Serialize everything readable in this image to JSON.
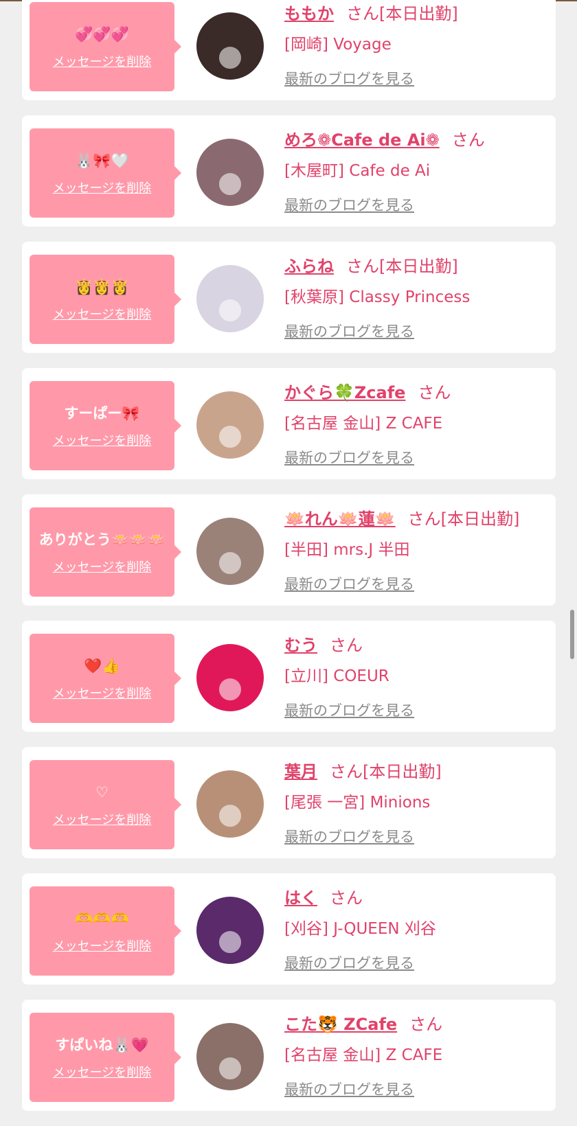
{
  "common": {
    "delete_label": "メッセージを削除",
    "blog_label": "最新のブログを見る",
    "honorific": "さん"
  },
  "colors": {
    "page_bg": "#efefef",
    "card_bg": "#ffffff",
    "bubble_bg": "#ff99aa",
    "accent_text": "#e0426a",
    "link_gray": "#8a8a8a"
  },
  "cards": [
    {
      "message": "💞💞💞",
      "name": "ももか",
      "status": "[本日出勤]",
      "shop": "[岡崎] Voyage",
      "avatar_color": "#3a2a28"
    },
    {
      "message": "🐰🎀🤍",
      "name": "めろ❁Cafe de Ai❁",
      "status": "",
      "shop": "[木屋町] Cafe de Ai",
      "avatar_color": "#8a6a70"
    },
    {
      "message": "👸👸👸",
      "name": "ふらね",
      "status": "[本日出勤]",
      "shop": "[秋葉原] Classy Princess",
      "avatar_color": "#d9d4e2"
    },
    {
      "message": "すーぱー🎀",
      "name": "かぐら🍀Zcafe",
      "status": "",
      "shop": "[名古屋 金山] Z CAFE",
      "avatar_color": "#c9a48c"
    },
    {
      "message": "ありがとう🪷🪷🪷",
      "name": "🪷れん🪷蓮🪷",
      "status": "[本日出勤]",
      "shop": "[半田] mrs.J 半田",
      "avatar_color": "#9a8278"
    },
    {
      "message": "❤️👍",
      "name": "むう",
      "status": "",
      "shop": "[立川] COEUR",
      "avatar_color": "#e0185a"
    },
    {
      "message": "♡",
      "name": "葉月",
      "status": "[本日出勤]",
      "shop": "[尾張 一宮] Minions",
      "avatar_color": "#b89078"
    },
    {
      "message": "🫶🫶🫶",
      "name": "はく",
      "status": "",
      "shop": "[刈谷] J-QUEEN 刈谷",
      "avatar_color": "#5a2a6a"
    },
    {
      "message": "すぱいね🐰💗",
      "name": "こた🐯 ZCafe",
      "status": "",
      "shop": "[名古屋 金山] Z CAFE",
      "avatar_color": "#8a7068"
    }
  ]
}
